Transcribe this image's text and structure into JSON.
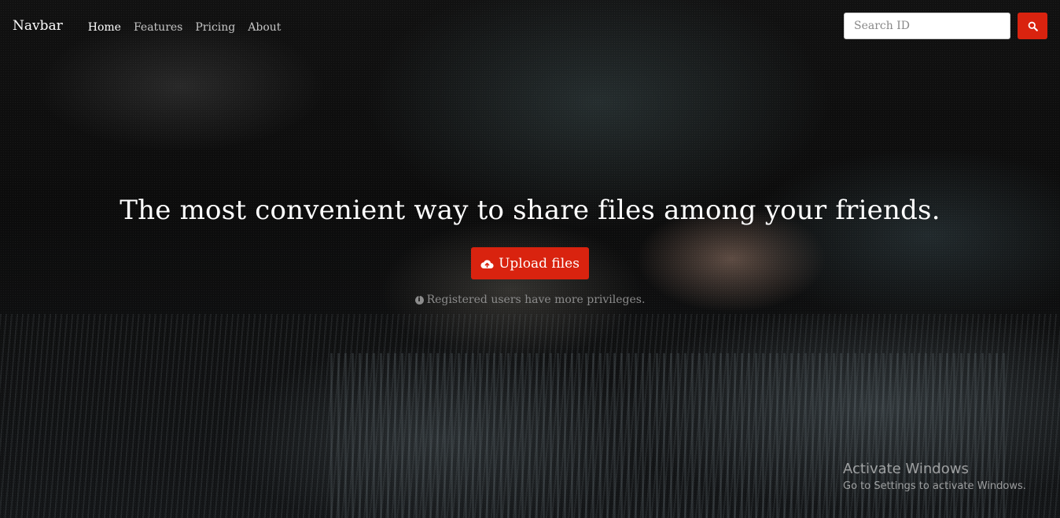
{
  "navbar": {
    "brand": "Navbar",
    "links": [
      {
        "label": "Home",
        "active": true
      },
      {
        "label": "Features",
        "active": false
      },
      {
        "label": "Pricing",
        "active": false
      },
      {
        "label": "About",
        "active": false
      }
    ],
    "search_placeholder": "Search ID",
    "search_icon": "search-icon"
  },
  "hero": {
    "title": "The most convenient way to share files among your friends.",
    "upload_label": "Upload files",
    "upload_icon": "cloud-upload-icon",
    "hint": "Registered users have more privileges.",
    "hint_icon": "info-icon"
  },
  "watermark": {
    "title": "Activate Windows",
    "subtitle": "Go to Settings to activate Windows."
  },
  "colors": {
    "accent": "#d9230f",
    "text": "#ffffff",
    "muted": "#8c8c8c"
  }
}
